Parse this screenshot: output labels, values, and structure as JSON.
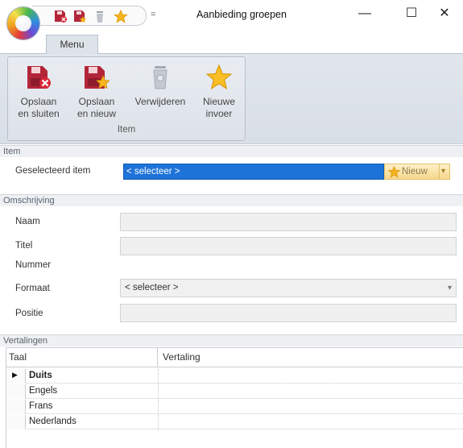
{
  "window": {
    "title": "Aanbieding groepen",
    "minimize_glyph": "—",
    "maximize_glyph": "☐",
    "close_glyph": "✕"
  },
  "quick_access": {
    "dropdown_glyph": "=",
    "icons": [
      "save-close-icon",
      "save-new-icon",
      "delete-icon",
      "star-icon"
    ]
  },
  "ribbon": {
    "tab": "Menu",
    "group_label": "Item",
    "buttons": [
      {
        "line1": "Opslaan",
        "line2": "en sluiten",
        "icon": "save-close-icon"
      },
      {
        "line1": "Opslaan",
        "line2": "en nieuw",
        "icon": "save-new-icon"
      },
      {
        "line1": "Verwijderen",
        "line2": "",
        "icon": "delete-icon"
      },
      {
        "line1": "Nieuwe",
        "line2": "invoer",
        "icon": "star-icon"
      }
    ]
  },
  "item_section": {
    "header": "Item",
    "label": "Geselecteerd item",
    "value": "< selecteer >",
    "new_button": "Nieuw",
    "dropdown_glyph": "▾"
  },
  "description_section": {
    "header": "Omschrijving",
    "fields": {
      "naam": "Naam",
      "titel": "Titel",
      "nummer": "Nummer",
      "formaat": "Formaat",
      "positie": "Positie"
    },
    "format_value": "< selecteer >",
    "format_dropdown_glyph": "▾"
  },
  "translations_section": {
    "header": "Vertalingen",
    "columns": [
      "Taal",
      "Vertaling"
    ],
    "rows": [
      {
        "taal": "Duits",
        "selected": true
      },
      {
        "taal": "Engels",
        "selected": false
      },
      {
        "taal": "Frans",
        "selected": false
      },
      {
        "taal": "Nederlands",
        "selected": false
      }
    ],
    "row_indicator_glyph": "▶"
  },
  "colors": {
    "selection_blue": "#1e73d8",
    "ribbon_bg": "#dde2e9",
    "new_button_gold": "#f6d78b"
  }
}
